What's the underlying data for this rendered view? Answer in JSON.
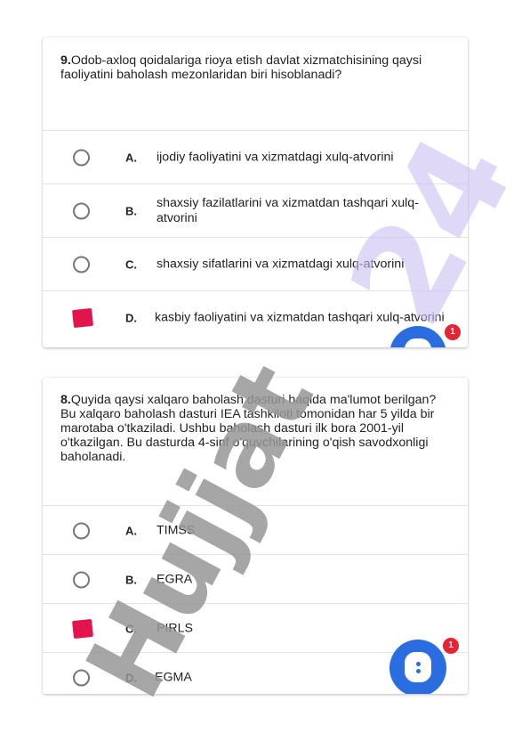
{
  "questions": [
    {
      "number": "9.",
      "text": "Odob-axloq qoidalariga rioya etish davlat xizmatchisining qaysi faoliyatini baholash mezonlaridan biri hisoblanadi?",
      "options": [
        {
          "letter": "A.",
          "text": "ijodiy faoliyatini va xizmatdagi xulq-atvorini",
          "selected": false
        },
        {
          "letter": "B.",
          "text": "shaxsiy fazilatlarini va xizmatdan tashqari xulq-atvorini",
          "selected": false
        },
        {
          "letter": "C.",
          "text": "shaxsiy sifatlarini va xizmatdagi xulq-atvorini",
          "selected": false
        },
        {
          "letter": "D.",
          "text": "kasbiy faoliyatini va xizmatdan tashqari xulq-atvorini",
          "selected": true
        }
      ]
    },
    {
      "number": "8.",
      "text": "Quyida qaysi xalqaro baholash dasturi haqida ma'lumot berilgan? Bu xalqaro baholash dasturi IEA tashkiloti tomonidan har 5 yilda bir marotaba o'tkaziladi. Ushbu baholash dasturi ilk bora 2001-yil o'tkazilgan. Bu dasturda 4-sinf o'quvchilarining o'qish savodxonligi baholanadi.",
      "options": [
        {
          "letter": "A.",
          "text": "TIMSS",
          "selected": false
        },
        {
          "letter": "B.",
          "text": "EGRA",
          "selected": false
        },
        {
          "letter": "C.",
          "text": "PIRLS",
          "selected": true
        },
        {
          "letter": "D.",
          "text": "EGMA",
          "selected": false
        }
      ]
    }
  ],
  "fab": {
    "badge_count": "1",
    "icon": "chat-bubble-icon",
    "color": "#2a6de0",
    "badge_color": "#e52435"
  },
  "watermark": {
    "left_text": "Hujjat",
    "right_text": "24",
    "left_color": "#9a9a9a",
    "right_color": "#c9bff2"
  },
  "colors": {
    "selected": "#e3144b"
  }
}
